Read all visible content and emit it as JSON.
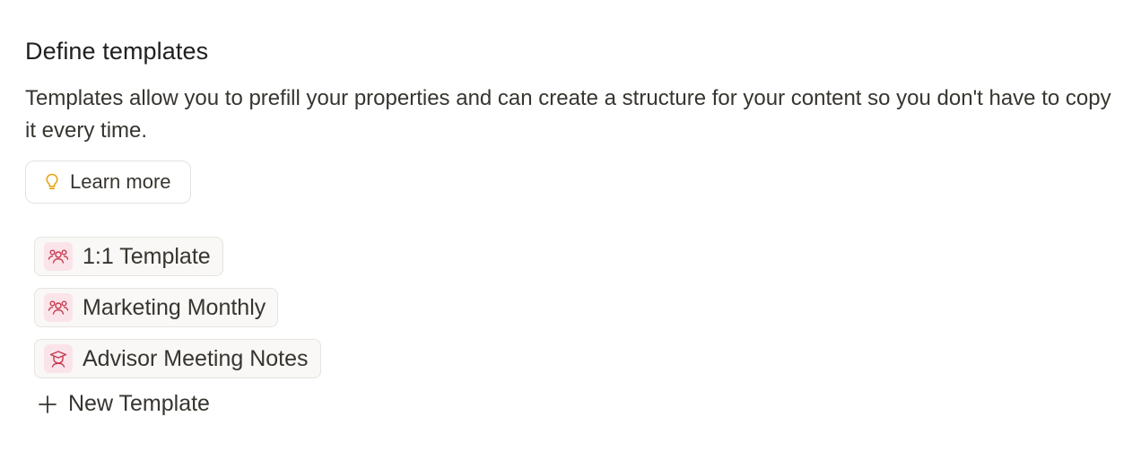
{
  "header": {
    "title": "Define templates",
    "description": "Templates allow you to prefill your properties and can create a structure for your content so you don't have to copy it every time."
  },
  "learn_more": {
    "label": "Learn more",
    "icon": "lightbulb-icon",
    "icon_color": "#e8a317"
  },
  "templates": [
    {
      "label": "1:1 Template",
      "icon": "people-icon"
    },
    {
      "label": "Marketing Monthly",
      "icon": "people-icon"
    },
    {
      "label": "Advisor Meeting Notes",
      "icon": "graduate-icon"
    }
  ],
  "template_icon_bg": "#fbe4e9",
  "template_icon_color": "#c4384f",
  "new_template": {
    "label": "New Template",
    "icon": "plus-icon"
  }
}
